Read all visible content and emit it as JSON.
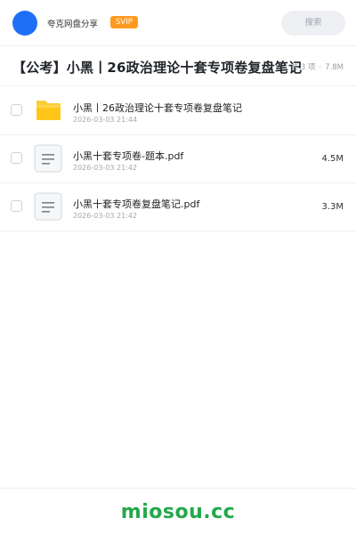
{
  "header": {
    "sharer_name": "夸克网盘分享",
    "badge": "SVIP",
    "search_placeholder": "搜索",
    "colors": {
      "avatar": "#1e6ff6",
      "badge": "#ff9a1f"
    }
  },
  "folder": {
    "title": "【公考】小黑丨26政治理论十套专项卷复盘笔记",
    "count": "共 3 项",
    "total_size": "7.8M"
  },
  "files": [
    {
      "name": "小黑丨26政治理论十套专项卷复盘笔记",
      "date": "2026-03-03 21:44",
      "size": "",
      "icon": "folder-icon"
    },
    {
      "name": "小黑十套专项卷-题本.pdf",
      "date": "2026-03-03 21:42",
      "size": "4.5M",
      "icon": "document-icon"
    },
    {
      "name": "小黑十套专项卷复盘笔记.pdf",
      "date": "2026-03-03 21:42",
      "size": "3.3M",
      "icon": "document-icon"
    }
  ],
  "footer": {
    "brand": "miosou.cc",
    "colors": {
      "brand": "#22a84a"
    }
  }
}
